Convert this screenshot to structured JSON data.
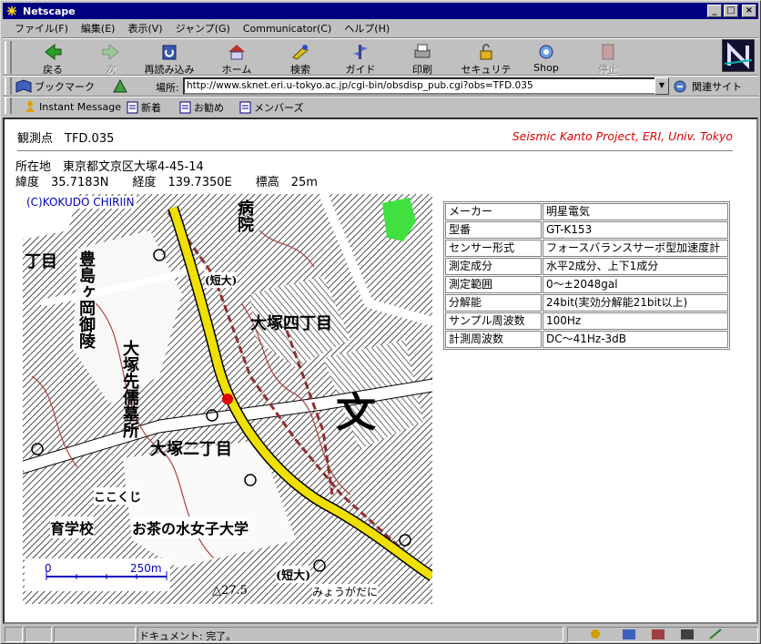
{
  "window": {
    "title": "Netscape"
  },
  "menu": [
    "ファイル(F)",
    "編集(E)",
    "表示(V)",
    "ジャンプ(G)",
    "Communicator(C)",
    "ヘルプ(H)"
  ],
  "nav": {
    "back": "戻る",
    "forward": "次",
    "reload": "再読み込み",
    "home": "ホーム",
    "search": "検索",
    "guide": "ガイド",
    "print": "印刷",
    "security": "セキュリティ",
    "shop": "Shop",
    "stop": "停止"
  },
  "location": {
    "bookmarks": "ブックマーク",
    "label": "場所:",
    "url": "http://www.sknet.eri.u-tokyo.ac.jp/cgi-bin/obsdisp_pub.cgi?obs=TFD.035",
    "related": "関連サイト"
  },
  "personal": {
    "instant_message": "Instant Message",
    "new": "新着",
    "recommend": "お勧め",
    "members": "メンバーズ"
  },
  "page": {
    "observation": "観測点　TFD.035",
    "project": "Seismic Kanto Project, ERI, Univ. Tokyo",
    "address": "所在地　東京都文京区大塚4-45-14",
    "coords": "緯度　35.7183N　　経度　139.7350E　　標高　25m"
  },
  "map": {
    "copyright": "(C)KOKUDO CHIRIIN",
    "scale_zero": "0",
    "scale_end": "250m",
    "labels": {
      "hospital": "病院",
      "chome": "丁目",
      "toshima": "豊島ヶ岡御陵",
      "otsuka_yontyome": "大塚四丁目",
      "otsuka_sentoku": "大塚先儒墓所",
      "bun": "文",
      "otsuka_nityome": "大塚二丁目",
      "kokokuji": "ここくじ",
      "ikugakko": "育学校",
      "ochanomizu": "お茶の水女子大学",
      "tandai_top": "(短大)",
      "tandai_bottom": "(短大)",
      "myogadani": "みょうがだに",
      "elev": "△27.5"
    }
  },
  "specs": [
    {
      "key": "メーカー",
      "value": "明星電気"
    },
    {
      "key": "型番",
      "value": "GT-K153"
    },
    {
      "key": "センサー形式",
      "value": "フォースバランスサーボ型加速度計"
    },
    {
      "key": "測定成分",
      "value": "水平2成分、上下1成分"
    },
    {
      "key": "測定範囲",
      "value": "0～±2048gal"
    },
    {
      "key": "分解能",
      "value": "24bit(実効分解能21bit以上)"
    },
    {
      "key": "サンプル周波数",
      "value": "100Hz"
    },
    {
      "key": "計測周波数",
      "value": "DC～41Hz-3dB"
    }
  ],
  "status": {
    "text": "ドキュメント: 完了。"
  },
  "colors": {
    "titlebar": "#000080",
    "project": "#e00000",
    "road": "#f0e000",
    "station_dot": "#e00000"
  }
}
